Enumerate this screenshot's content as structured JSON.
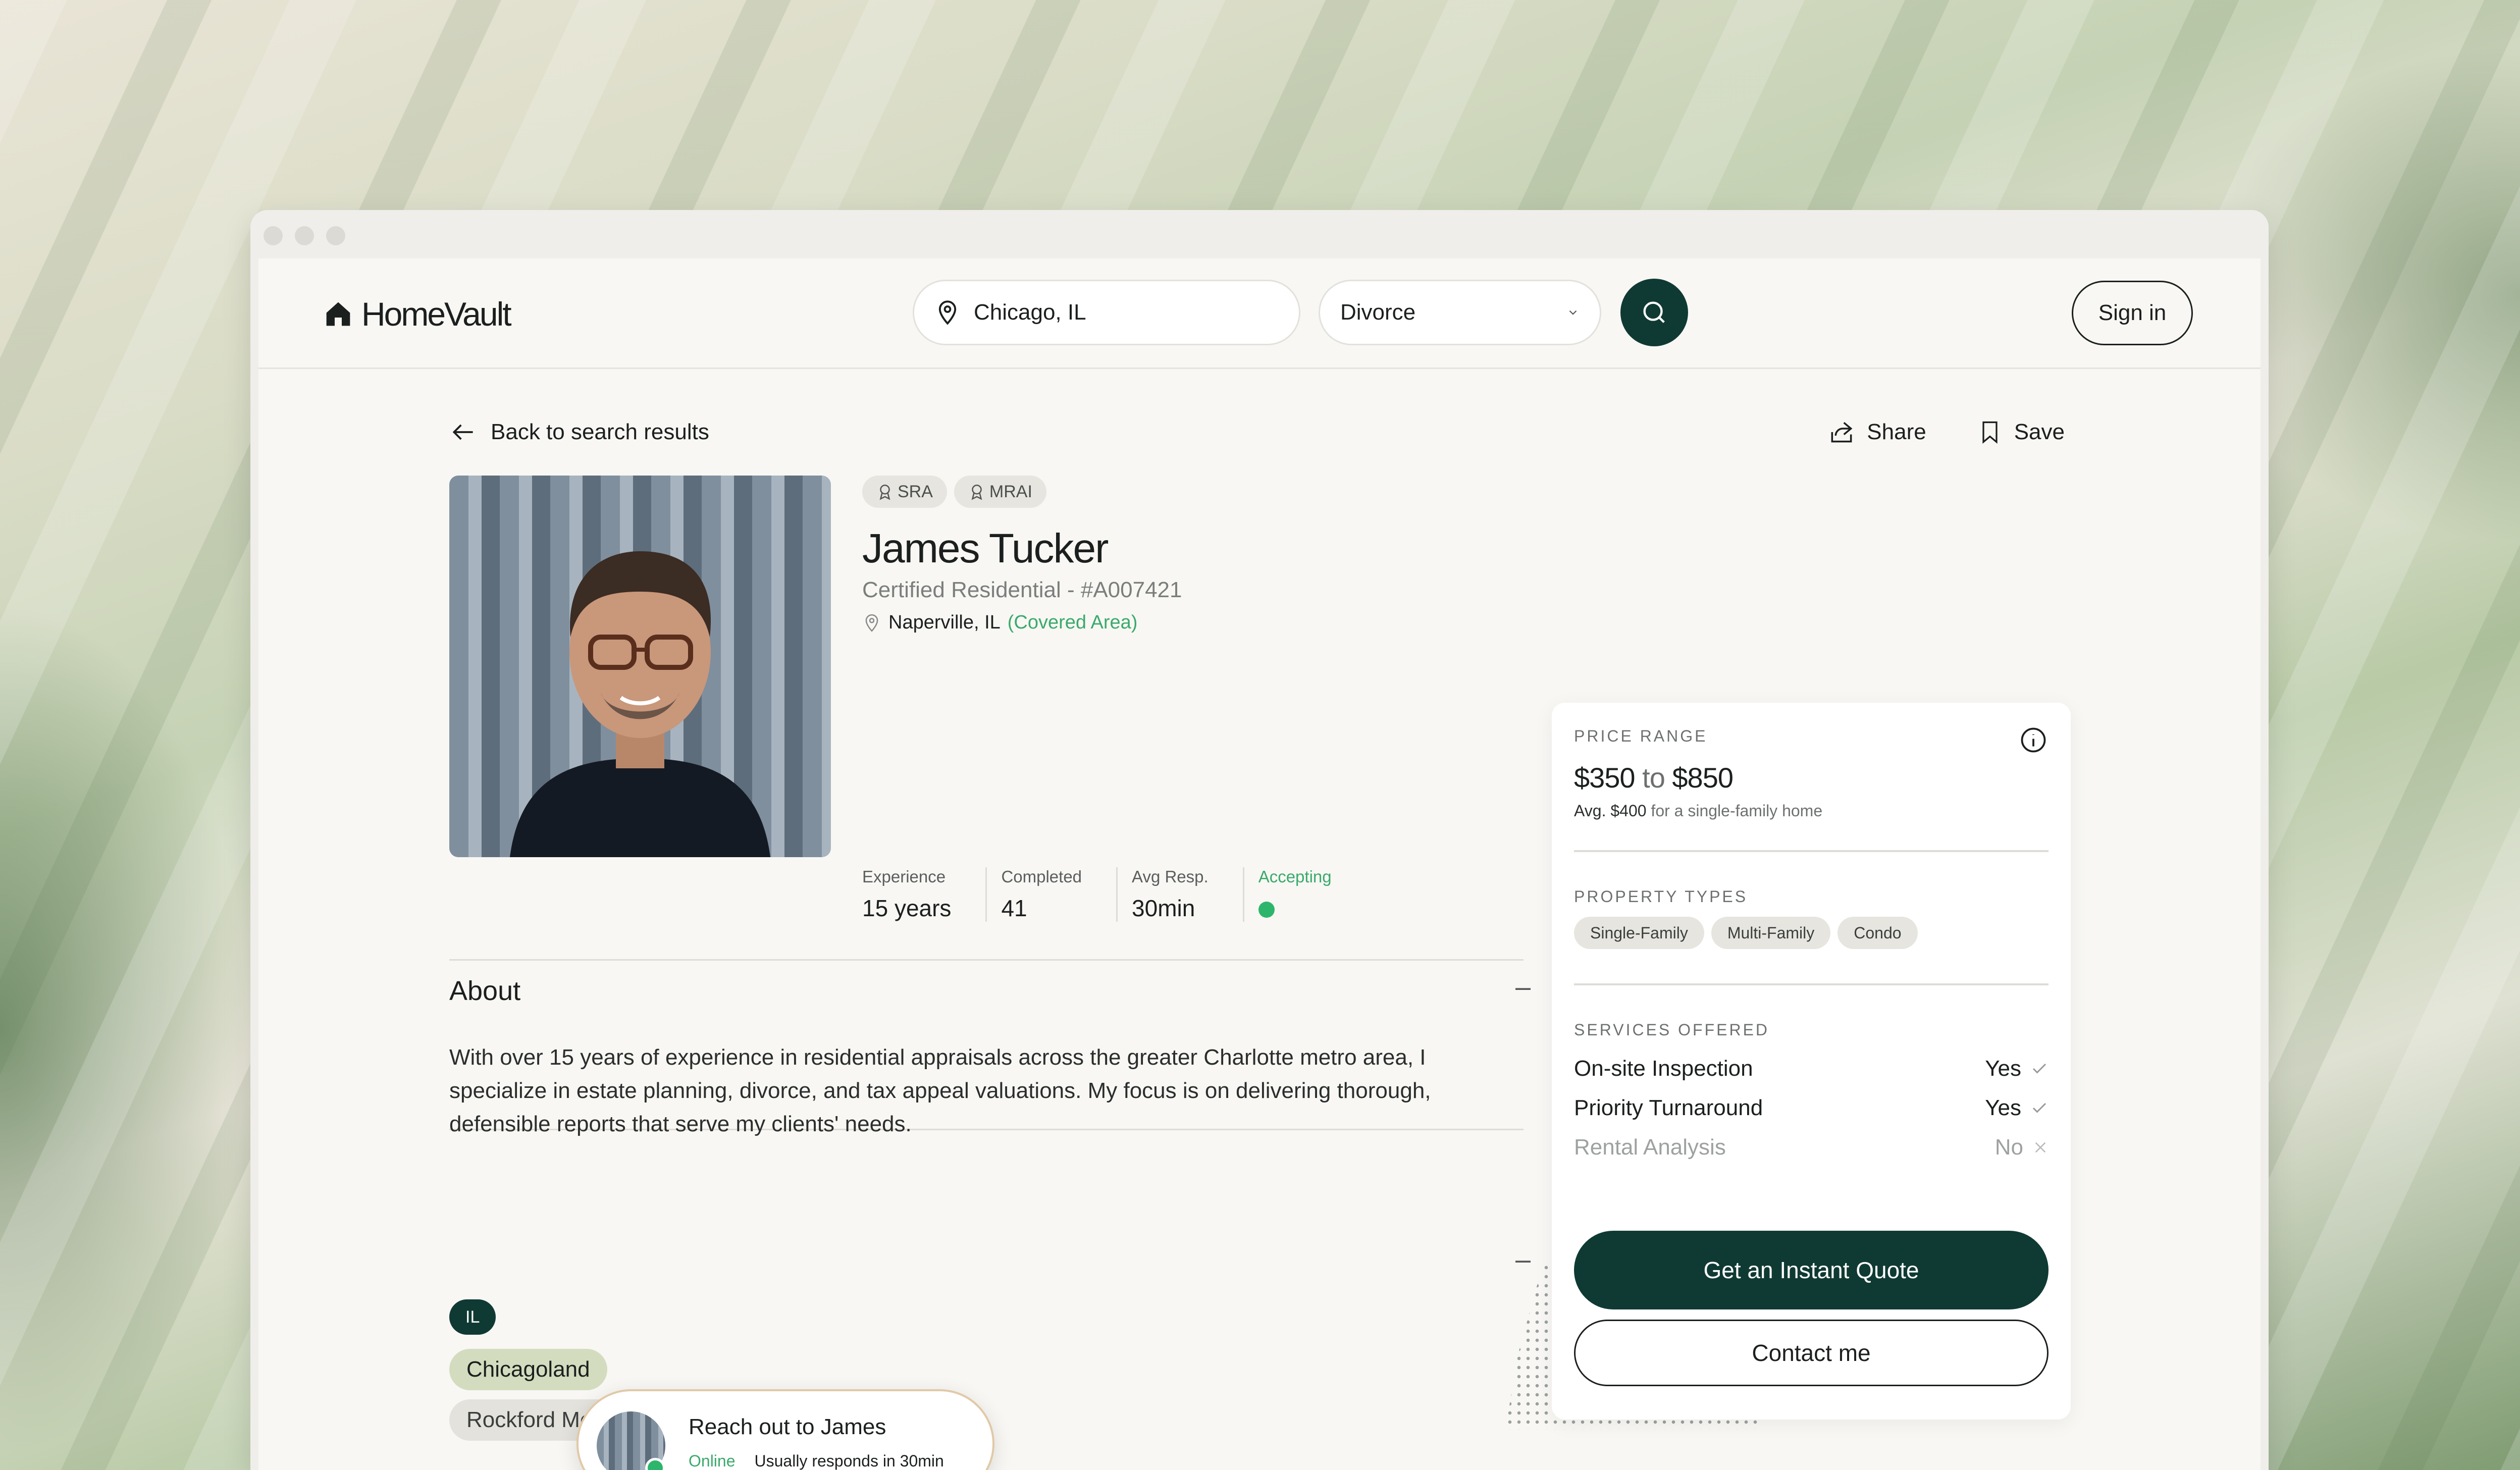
{
  "brand": {
    "name": "HomeVault"
  },
  "search": {
    "location_value": "Chicago, IL",
    "type_selected": "Divorce"
  },
  "header": {
    "signin_label": "Sign in"
  },
  "nav": {
    "back_label": "Back to search results",
    "share_label": "Share",
    "save_label": "Save"
  },
  "profile": {
    "badges": [
      "SRA",
      "MRAI"
    ],
    "name": "James Tucker",
    "license": "Certified Residential - #A007421",
    "location": "Naperville, IL",
    "coverage": "(Covered Area)",
    "stats": [
      {
        "label": "Experience",
        "value": "15 years"
      },
      {
        "label": "Completed",
        "value": "41"
      },
      {
        "label": "Avg Resp.",
        "value": "30min"
      }
    ],
    "accepting_label": "Accepting",
    "status_color": "#2db66b"
  },
  "about": {
    "title": "About",
    "text": "With over 15 years of experience in residential appraisals across the greater Charlotte metro area, I specialize in estate planning, divorce, and tax appeal valuations. My focus is on delivering thorough, defensible reports that serve my clients' needs."
  },
  "coverage": {
    "state_tag": "IL",
    "regions": [
      "Chicagoland",
      "Rockford Metro"
    ]
  },
  "card": {
    "price_label": "PRICE RANGE",
    "price_min": "$350",
    "price_to": "to",
    "price_max": "$850",
    "avg_value": "Avg. $400",
    "avg_note": "for a single-family home",
    "property_label": "PROPERTY TYPES",
    "property_types": [
      "Single-Family",
      "Multi-Family",
      "Condo"
    ],
    "services_label": "SERVICES OFFERED",
    "services": [
      {
        "name": "On-site Inspection",
        "answer": "Yes"
      },
      {
        "name": "Priority Turnaround",
        "answer": "Yes"
      },
      {
        "name": "Rental Analysis",
        "answer": "No"
      }
    ],
    "quote_label": "Get an Instant Quote",
    "contact_label": "Contact me"
  },
  "reach": {
    "title": "Reach out to James",
    "status": "Online",
    "responds": "Usually responds in 30min"
  },
  "colors": {
    "accent": "#0f3a33",
    "green": "#3aaa6b",
    "border_warm": "#e1c9a7"
  }
}
